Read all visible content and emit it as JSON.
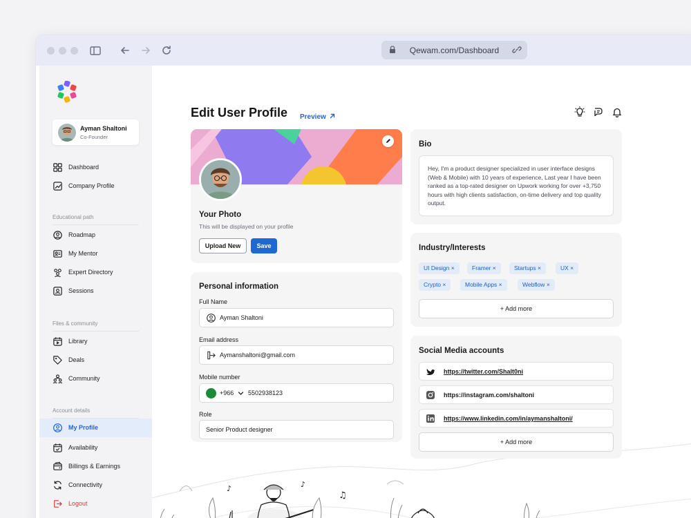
{
  "browser": {
    "url": "Qewam.com/Dashboard"
  },
  "sidebar": {
    "user": {
      "name": "Ayman Shaltoni",
      "role": "Co-Founder"
    },
    "main_items": [
      {
        "label": "Dashboard",
        "icon": "dashboard-icon"
      },
      {
        "label": "Company Profile",
        "icon": "chart-icon"
      }
    ],
    "sections": {
      "educational": "Educational path",
      "files": "Files & community",
      "account": "Account details"
    },
    "educational_items": [
      {
        "label": "Roadmap",
        "icon": "roadmap-icon"
      },
      {
        "label": "My Mentor",
        "icon": "mentor-icon"
      },
      {
        "label": "Expert Directory",
        "icon": "people-icon"
      },
      {
        "label": "Sessions",
        "icon": "sessions-icon"
      }
    ],
    "files_items": [
      {
        "label": "Library",
        "icon": "library-icon"
      },
      {
        "label": "Deals",
        "icon": "tag-icon"
      },
      {
        "label": "Community",
        "icon": "community-icon"
      }
    ],
    "account_items": [
      {
        "label": "My Profile",
        "icon": "user-icon",
        "active": true
      },
      {
        "label": "Availability",
        "icon": "calendar-icon"
      },
      {
        "label": "Billings & Earnings",
        "icon": "wallet-icon"
      },
      {
        "label": "Connectivity",
        "icon": "sync-icon"
      }
    ],
    "logout": "Logout"
  },
  "header": {
    "title": "Edit User Profile",
    "preview": "Preview"
  },
  "photo_card": {
    "title": "Your Photo",
    "subtitle": "This will be displayed on your profile",
    "upload_label": "Upload New",
    "save_label": "Save"
  },
  "personal": {
    "title": "Personal information",
    "full_name_label": "Full Name",
    "full_name": "Ayman Shaltoni",
    "email_label": "Email address",
    "email": "Aymanshaltoni@gmail.com",
    "mobile_label": "Mobile number",
    "country_code": "+966",
    "phone": "5502938123",
    "role_label": "Role",
    "role": "Senior Product designer"
  },
  "bio": {
    "title": "Bio",
    "text": "Hey, I'm a product designer specialized in user interface designs (Web & Mobile) with 10 years of experience, Last year I have been ranked as a top-rated designer on Upwork working for over +3,750 hours with high clients satisfaction, on-time delivery and top quality output."
  },
  "interests": {
    "title": "Industry/Interests",
    "tags": [
      "UI Design",
      "Framer",
      "Startups",
      "UX",
      "Crypto",
      "Mobile Apps",
      "Webflow"
    ],
    "add_more": "+ Add more"
  },
  "social": {
    "title": "Social Media accounts",
    "links": [
      {
        "url": "https://twitter.com/Shalt0ni",
        "icon": "twitter-icon"
      },
      {
        "url": "https://instagram.com/shaltoni",
        "icon": "instagram-icon"
      },
      {
        "url": "https://www.linkedin.com/in/aymanshaltoni/",
        "icon": "linkedin-icon"
      }
    ],
    "add_more": "+ Add more"
  },
  "colors": {
    "accent": "#1f67d3",
    "danger": "#d63a3a",
    "tag_bg": "#e2ebf8"
  }
}
